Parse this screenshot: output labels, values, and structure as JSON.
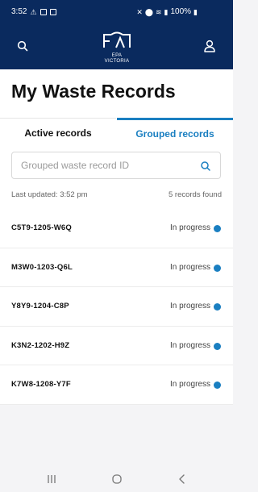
{
  "status_bar": {
    "time": "3:52",
    "battery": "100%"
  },
  "app_bar": {
    "logo_text": "EPA\nVICTORIA",
    "logo_line1": "EPA",
    "logo_line2": "VICTORIA",
    "search_icon": "search-icon",
    "account_icon": "user-icon"
  },
  "page": {
    "title": "My Waste Records"
  },
  "tabs": [
    {
      "label": "Active records",
      "selected": false
    },
    {
      "label": "Grouped records",
      "selected": true
    }
  ],
  "search": {
    "placeholder": "Grouped waste record ID",
    "value": ""
  },
  "meta": {
    "last_updated": "Last updated: 3:52 pm",
    "count": "5 records found"
  },
  "records": [
    {
      "id": "C5T9-1205-W6Q",
      "status": "In progress"
    },
    {
      "id": "M3W0-1203-Q6L",
      "status": "In progress"
    },
    {
      "id": "Y8Y9-1204-C8P",
      "status": "In progress"
    },
    {
      "id": "K3N2-1202-H9Z",
      "status": "In progress"
    },
    {
      "id": "K7W8-1208-Y7F",
      "status": "In progress"
    }
  ],
  "colors": {
    "header": "#0a2a5e",
    "accent": "#1a7fc1",
    "status_dot": "#1a7fc1"
  }
}
